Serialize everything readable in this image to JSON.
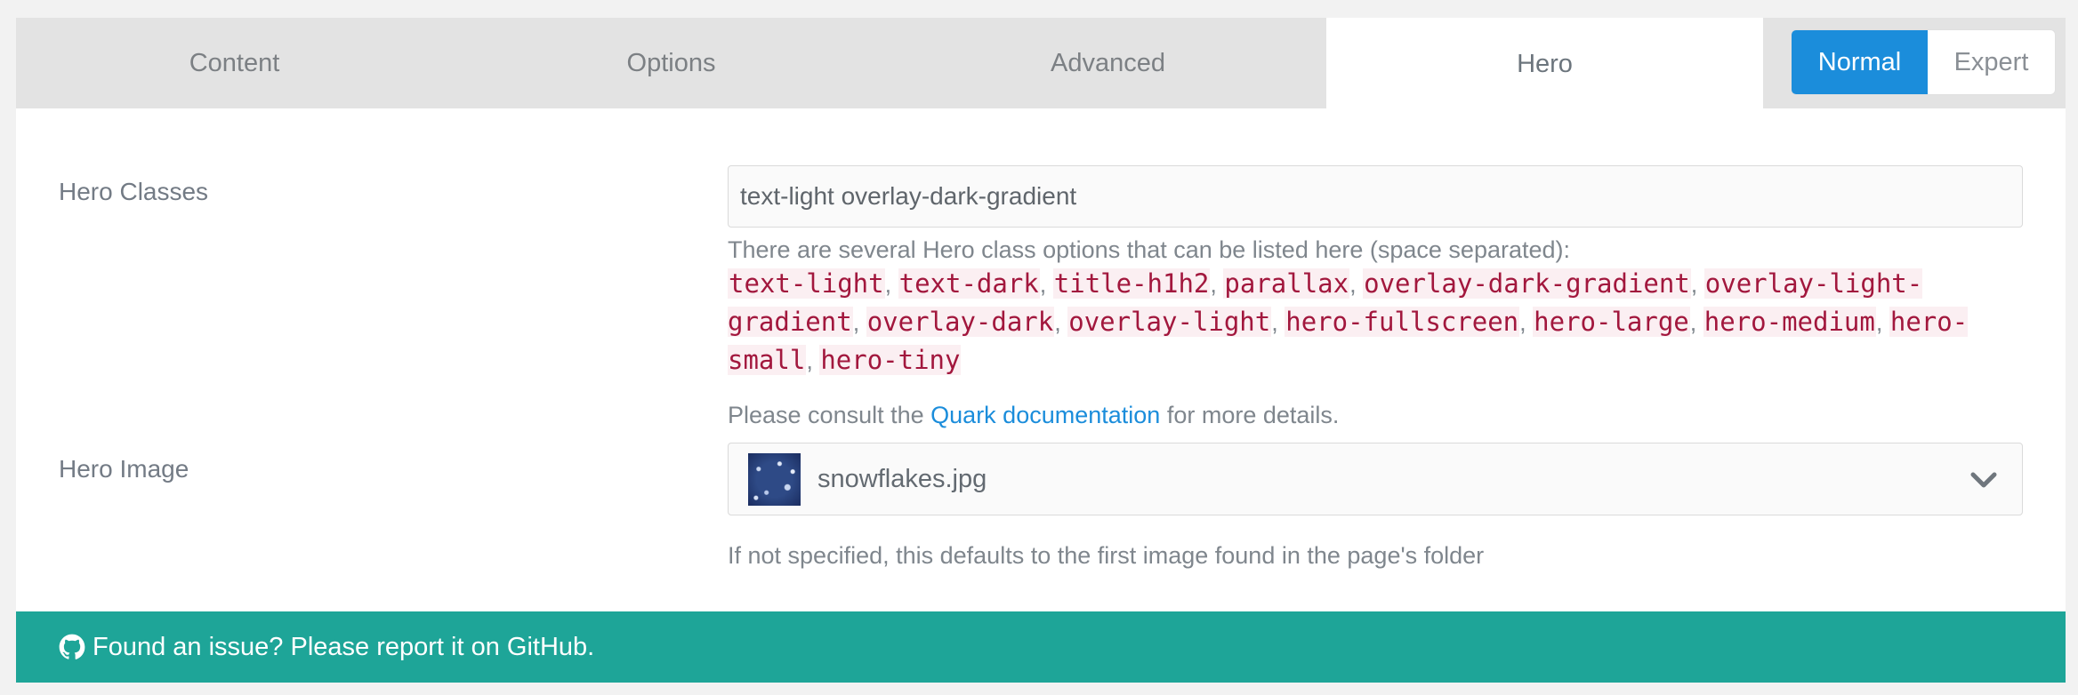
{
  "tabs": {
    "content": "Content",
    "options": "Options",
    "advanced": "Advanced",
    "hero": "Hero"
  },
  "mode": {
    "normal": "Normal",
    "expert": "Expert",
    "selected": "Normal"
  },
  "hero_classes": {
    "label": "Hero Classes",
    "value": "text-light overlay-dark-gradient",
    "help_intro": "There are several Hero class options that can be listed here (space separated):",
    "options": [
      "text-light",
      "text-dark",
      "title-h1h2",
      "parallax",
      "overlay-dark-gradient",
      "overlay-light-gradient",
      "overlay-dark",
      "overlay-light",
      "hero-fullscreen",
      "hero-large",
      "hero-medium",
      "hero-small",
      "hero-tiny"
    ],
    "consult_prefix": "Please consult the ",
    "consult_link": "Quark documentation",
    "consult_suffix": " for more details."
  },
  "hero_image": {
    "label": "Hero Image",
    "value": "snowflakes.jpg",
    "help": "If not specified, this defaults to the first image found in the page's folder"
  },
  "footer": {
    "text": "Found an issue? Please report it on GitHub."
  },
  "colors": {
    "accent_blue": "#1b8ddb",
    "footer_teal": "#1ea598",
    "code_red": "#a2173d"
  },
  "icons": {
    "footer": "github-icon",
    "select": "chevron-down-icon"
  }
}
